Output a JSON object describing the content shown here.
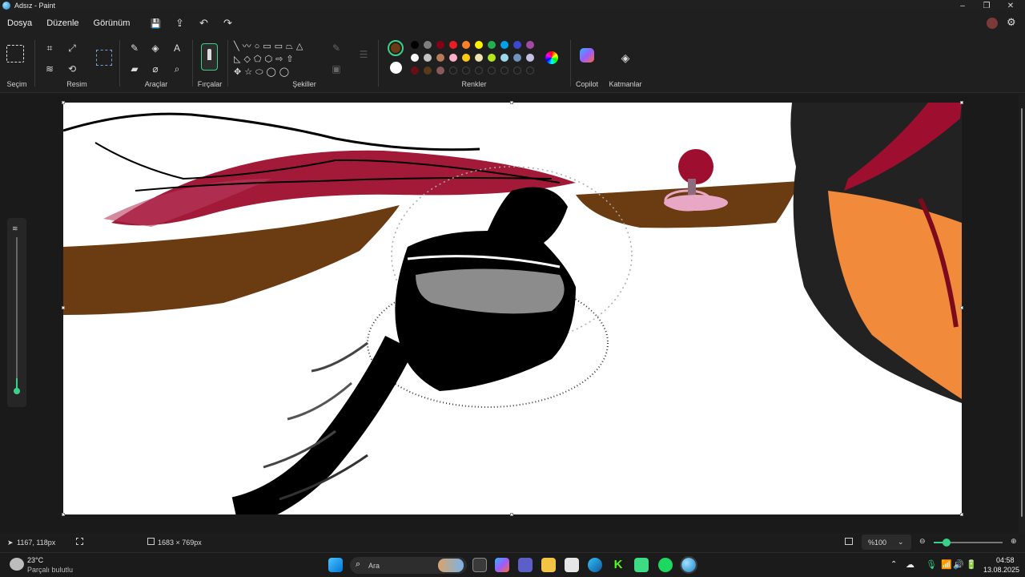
{
  "window": {
    "title": "Adsız - Paint",
    "minimize": "–",
    "maximize": "❐",
    "close": "✕"
  },
  "menu": {
    "items": [
      "Dosya",
      "Düzenle",
      "Görünüm"
    ]
  },
  "quick_access": {
    "save": "💾",
    "share": "⇪",
    "undo": "↶",
    "redo": "↷"
  },
  "ribbon": {
    "groups": {
      "selection": "Seçim",
      "image": "Resim",
      "tools": "Araçlar",
      "brushes": "Fırçalar",
      "shapes": "Şekiller",
      "colors": "Renkler",
      "copilot": "Copilot",
      "layers": "Katmanlar"
    },
    "primary_color": "#6b3b12",
    "secondary_color": "#ffffff",
    "palette_row1": [
      "#000000",
      "#7f7f7f",
      "#880015",
      "#ed1c24",
      "#ff7f27",
      "#fff200",
      "#22b14c",
      "#00a2e8",
      "#3f48cc",
      "#a349a4"
    ],
    "palette_row2": [
      "#ffffff",
      "#c3c3c3",
      "#b97a57",
      "#ffaec9",
      "#ffc90e",
      "#efe4b0",
      "#b5e61d",
      "#99d9ea",
      "#7092be",
      "#c8bfe7"
    ],
    "palette_row3": [
      "#6b0d16",
      "#5a3a1a",
      "#8a5a5a"
    ]
  },
  "status": {
    "cursor_pos": "1167, 118px",
    "canvas_size": "1683 × 769px",
    "zoom": "%100"
  },
  "taskbar": {
    "weather_temp": "23°C",
    "weather_desc": "Parçalı bulutlu",
    "search_placeholder": "Ara",
    "time": "04:58",
    "date": "13.08.2025"
  }
}
